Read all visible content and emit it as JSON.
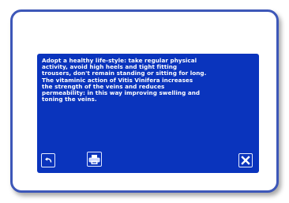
{
  "info_screen": {
    "message": "Adopt a healthy life-style: take regular physical\nactivity, avoid high heels and tight fitting\ntrousers, don't remain standing or sitting for long.\nThe vitaminic action of Vitis Vinifera increases\nthe strength of the veins and reduces\npermeability: in this way improving swelling and\ntoning the veins."
  },
  "icons": {
    "back": "back-arrow-icon",
    "print": "printer-icon",
    "close": "close-icon"
  },
  "colors": {
    "frame_border": "#3d57b8",
    "screen_background": "#0a34bd",
    "text": "#ffffff"
  }
}
